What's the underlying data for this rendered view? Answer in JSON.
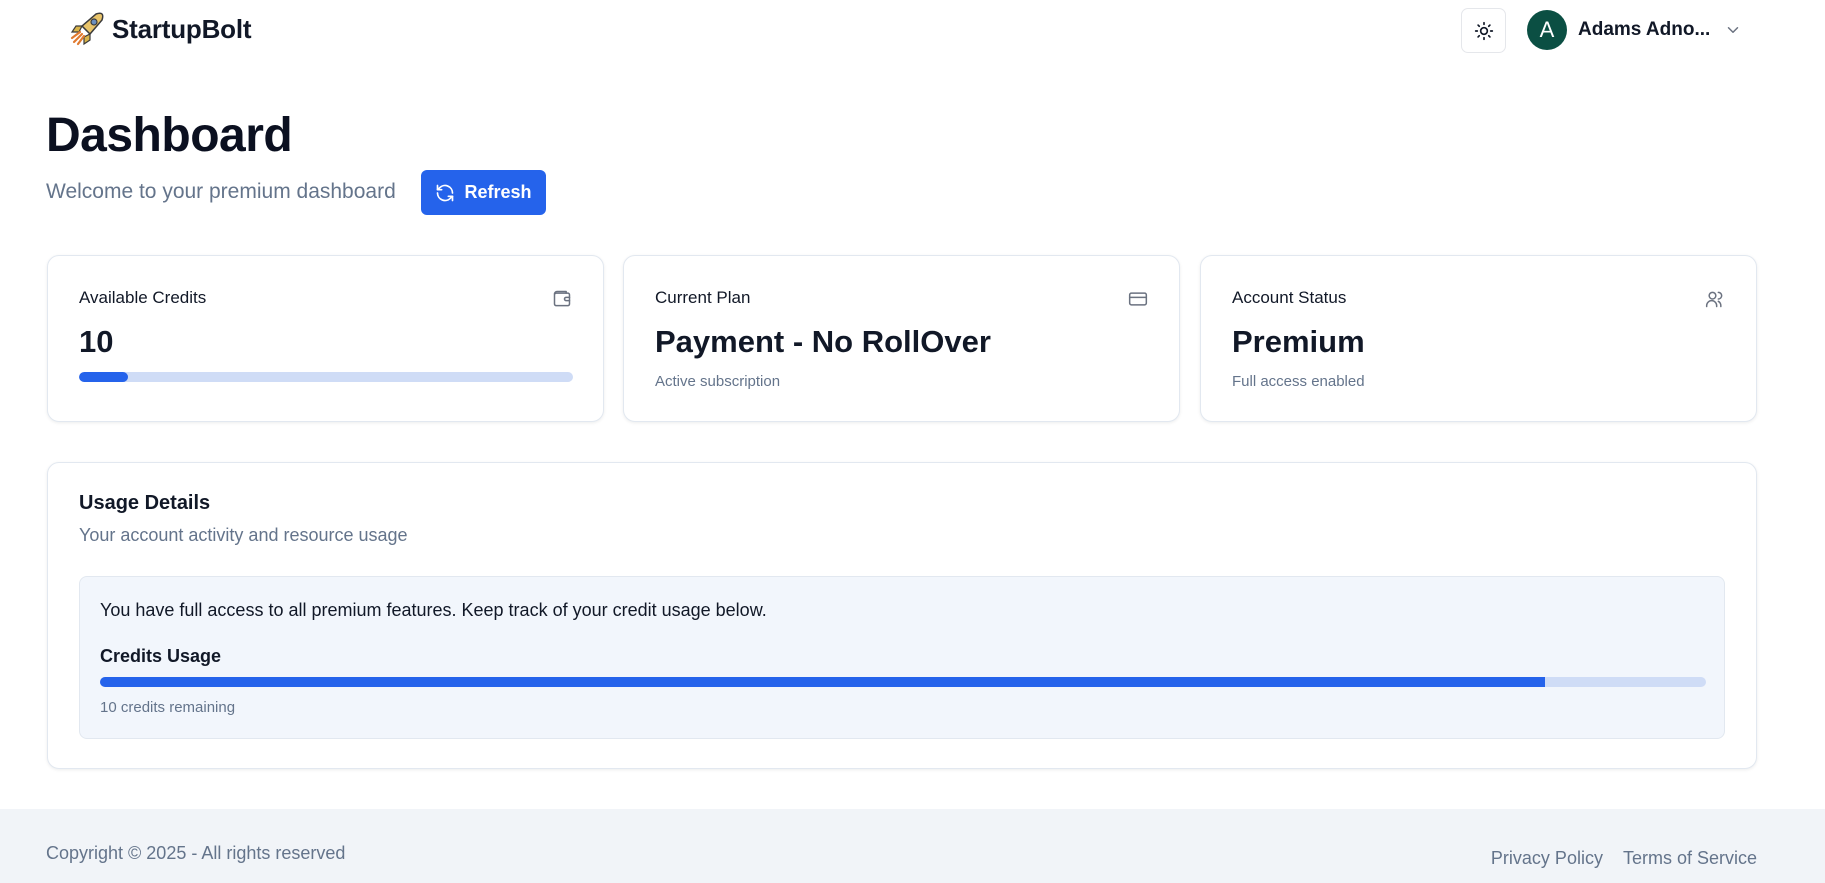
{
  "header": {
    "brand_name": "StartupBolt",
    "brand_logo_icon": "rocket-icon",
    "theme_toggle_icon": "sun-icon",
    "user": {
      "avatar_initial": "A",
      "avatar_color": "#0b4f43",
      "name": "Adams Adno...",
      "menu_icon": "chevron-down-icon"
    }
  },
  "page": {
    "title": "Dashboard",
    "subtitle": "Welcome to your premium dashboard",
    "refresh_label": "Refresh",
    "refresh_icon": "refresh-icon"
  },
  "cards": {
    "credits": {
      "label": "Available Credits",
      "value": "10",
      "icon": "wallet-icon",
      "progress_fraction": 0.1
    },
    "plan": {
      "label": "Current Plan",
      "value": "Payment - No RollOver",
      "sub": "Active subscription",
      "icon": "credit-card-icon"
    },
    "status": {
      "label": "Account Status",
      "value": "Premium",
      "sub": "Full access enabled",
      "icon": "users-icon"
    }
  },
  "usage": {
    "title": "Usage Details",
    "description": "Your account activity and resource usage",
    "info_text": "You have full access to all premium features. Keep track of your credit usage below.",
    "credits_label": "Credits Usage",
    "progress_fraction": 0.9,
    "remaining_text": "10 credits remaining"
  },
  "footer": {
    "copyright": "Copyright © 2025 - All rights reserved",
    "links": [
      "Privacy Policy",
      "Terms of Service"
    ]
  },
  "colors": {
    "accent": "#2563eb",
    "track": "#cfdcf6",
    "muted_text": "#64748b",
    "footer_bg": "#f1f4f8"
  }
}
